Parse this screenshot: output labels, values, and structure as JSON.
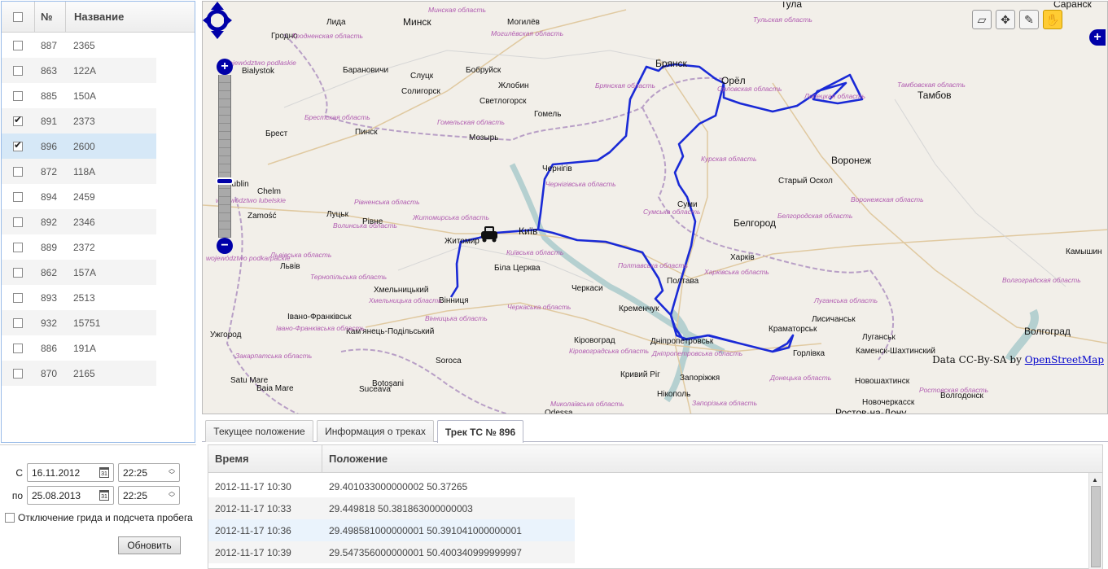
{
  "vehicles": {
    "columns": {
      "num": "№",
      "name": "Название"
    },
    "rows": [
      {
        "num": "887",
        "name": "2365",
        "checked": false
      },
      {
        "num": "863",
        "name": "122А",
        "checked": false
      },
      {
        "num": "885",
        "name": "150А",
        "checked": false
      },
      {
        "num": "891",
        "name": "2373",
        "checked": true
      },
      {
        "num": "896",
        "name": "2600",
        "checked": true,
        "selected": true
      },
      {
        "num": "872",
        "name": "118А",
        "checked": false
      },
      {
        "num": "894",
        "name": "2459",
        "checked": false
      },
      {
        "num": "892",
        "name": "2346",
        "checked": false
      },
      {
        "num": "889",
        "name": "2372",
        "checked": false
      },
      {
        "num": "862",
        "name": "157А",
        "checked": false
      },
      {
        "num": "893",
        "name": "2513",
        "checked": false
      },
      {
        "num": "932",
        "name": "15751",
        "checked": false
      },
      {
        "num": "886",
        "name": "191А",
        "checked": false
      },
      {
        "num": "870",
        "name": "2165",
        "checked": false
      }
    ]
  },
  "filter": {
    "from_label": "С",
    "from_date": "16.11.2012",
    "from_time": "22:25",
    "to_label": "по",
    "to_date": "25.08.2013",
    "to_time": "22:25",
    "grid_option_label": "Отключение грида и подсчета пробега",
    "grid_option_checked": false,
    "refresh_label": "Обновить"
  },
  "map": {
    "attribution_prefix": "Data CC-By-SA by",
    "attribution_link": "OpenStreetMap",
    "cities": [
      {
        "name": "Минск",
        "big": true
      },
      {
        "name": "Брянск",
        "big": true
      },
      {
        "name": "Орёл",
        "big": true
      },
      {
        "name": "Тамбов",
        "big": true
      },
      {
        "name": "Воронеж",
        "big": true
      },
      {
        "name": "Белгород",
        "big": true
      },
      {
        "name": "Київ",
        "big": true
      },
      {
        "name": "Волгоград",
        "big": true
      },
      {
        "name": "Ростов-на-Дону",
        "big": true
      },
      {
        "name": "Тула",
        "big": true
      },
      {
        "name": "Саранск",
        "big": true
      },
      {
        "name": "Лида"
      },
      {
        "name": "Гродно"
      },
      {
        "name": "Bialystok"
      },
      {
        "name": "Барановичи"
      },
      {
        "name": "Слуцк"
      },
      {
        "name": "Солигорск"
      },
      {
        "name": "Бобруйск"
      },
      {
        "name": "Жлобин"
      },
      {
        "name": "Светлогорск"
      },
      {
        "name": "Гомель"
      },
      {
        "name": "Могилёв"
      },
      {
        "name": "Мозырь"
      },
      {
        "name": "Брест"
      },
      {
        "name": "Пинск"
      },
      {
        "name": "Chelm"
      },
      {
        "name": "Zamość"
      },
      {
        "name": "Луцьк"
      },
      {
        "name": "Рівне"
      },
      {
        "name": "Житомир"
      },
      {
        "name": "Чернігів"
      },
      {
        "name": "Суми"
      },
      {
        "name": "Старый Оскол"
      },
      {
        "name": "Харків"
      },
      {
        "name": "Полтава"
      },
      {
        "name": "Кременчук"
      },
      {
        "name": "Черкаси"
      },
      {
        "name": "Біла Церква"
      },
      {
        "name": "Вінниця"
      },
      {
        "name": "Хмельницький"
      },
      {
        "name": "Львів"
      },
      {
        "name": "Івано-Франківськ"
      },
      {
        "name": "Кам'янець-Подільський"
      },
      {
        "name": "Ужгород"
      },
      {
        "name": "Кіровоград"
      },
      {
        "name": "Дніпропетровськ"
      },
      {
        "name": "Кривий Ріг"
      },
      {
        "name": "Запоріжжя"
      },
      {
        "name": "Нікополь"
      },
      {
        "name": "Краматорськ"
      },
      {
        "name": "Лисичанськ"
      },
      {
        "name": "Луганськ"
      },
      {
        "name": "Горлівка"
      },
      {
        "name": "Каменск-Шахтинский"
      },
      {
        "name": "Новошахтинск"
      },
      {
        "name": "Новочеркасск"
      },
      {
        "name": "Волгодонск"
      },
      {
        "name": "Камышин"
      },
      {
        "name": "Soroca"
      },
      {
        "name": "Botoşani"
      },
      {
        "name": "Suceava"
      },
      {
        "name": "Satu Mare"
      },
      {
        "name": "Baia Mare"
      },
      {
        "name": "Lublin"
      },
      {
        "name": "Odessa"
      }
    ],
    "regions": [
      "Гродненская область",
      "Минская область",
      "Могилёвская область",
      "Брестская область",
      "Гомельская область",
      "Брянская область",
      "Орловская область",
      "Липецкая область",
      "Тамбовская область",
      "Курская область",
      "Воронежская область",
      "Белгородская область",
      "Тульская область",
      "Сумська область",
      "Харківська область",
      "Полтавська область",
      "Чернігівська область",
      "Київська область",
      "Житомирська область",
      "Рівненська область",
      "Волинська область",
      "Львівська область",
      "Тернопільська область",
      "Хмельницька область",
      "Вінницька область",
      "Черкаська область",
      "Кіровоградська область",
      "Дніпропетровська область",
      "Запорізька область",
      "Донецька область",
      "Луганська область",
      "Миколаївська область",
      "Закарпатська область",
      "Івано-Франківська область",
      "Ростовская область",
      "Волгоградская область",
      "województwo podlaskie",
      "województwo lubelskie",
      "województwo podkarpackie"
    ],
    "tools": [
      "select-box",
      "move",
      "pencil",
      "hand"
    ]
  },
  "tabs": [
    {
      "label": "Текущее положение",
      "active": false
    },
    {
      "label": "Информация о треках",
      "active": false
    },
    {
      "label": "Трек ТС № 896",
      "active": true
    }
  ],
  "track": {
    "columns": {
      "time": "Время",
      "position": "Положение"
    },
    "rows": [
      {
        "time": "2012-11-17 10:30",
        "position": "29.401033000000002 50.37265"
      },
      {
        "time": "2012-11-17 10:33",
        "position": "29.449818 50.381863000000003"
      },
      {
        "time": "2012-11-17 10:36",
        "position": "29.498581000000001 50.391041000000001",
        "selected": true
      },
      {
        "time": "2012-11-17 10:39",
        "position": "29.547356000000001 50.400340999999997"
      }
    ]
  }
}
